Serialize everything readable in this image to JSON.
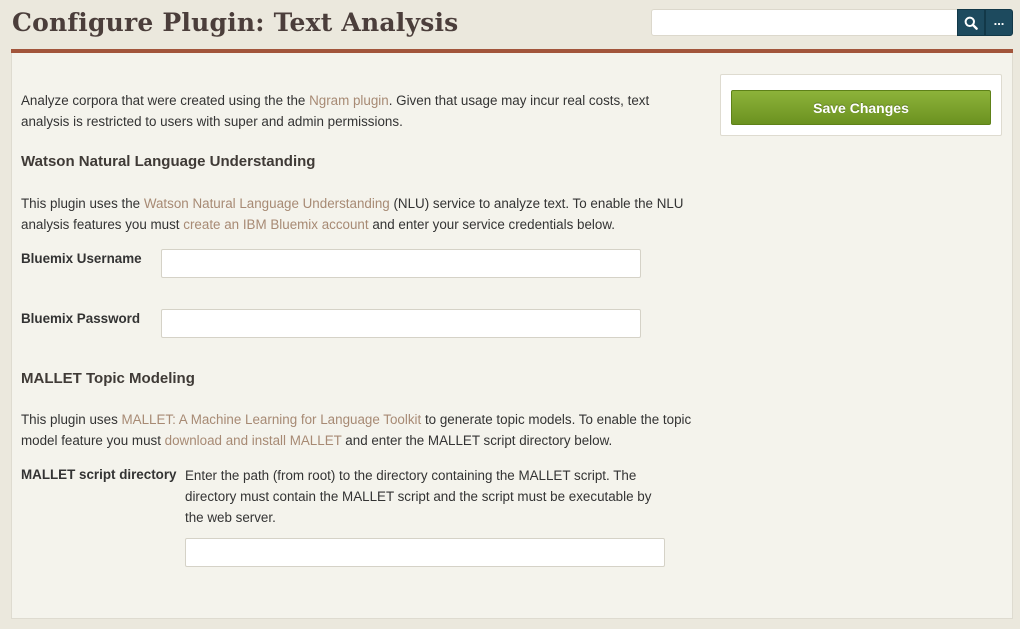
{
  "header": {
    "title": "Configure Plugin: Text Analysis",
    "search": {
      "value": "",
      "placeholder": "",
      "button_icon": "search-icon",
      "options_label": "..."
    }
  },
  "save": {
    "label": "Save Changes"
  },
  "intro": {
    "text_before": "Analyze corpora that were created using the the ",
    "link": "Ngram plugin",
    "text_after": ". Given that usage may incur real costs, text analysis is restricted to users with super and admin permissions."
  },
  "watson": {
    "heading": "Watson Natural Language Understanding",
    "desc_1": "This plugin uses the ",
    "link_1": "Watson Natural Language Understanding",
    "desc_2": " (NLU) service to analyze text. To enable the NLU analysis features you must ",
    "link_2": "create an IBM Bluemix account",
    "desc_3": " and enter your service credentials below.",
    "username_label": "Bluemix Username",
    "username_value": "",
    "password_label": "Bluemix Password",
    "password_value": ""
  },
  "mallet": {
    "heading": "MALLET Topic Modeling",
    "desc_1": "This plugin uses ",
    "link_1": "MALLET: A Machine Learning for Language Toolkit",
    "desc_2": " to generate topic models. To enable the topic model feature you must ",
    "link_2": "download and install MALLET",
    "desc_3": " and enter the MALLET script directory below.",
    "dir_label": "MALLET script directory",
    "dir_hint": "Enter the path (from root) to the directory containing the MALLET script. The directory must contain the MALLET script and the script must be executable by the web server.",
    "dir_value": ""
  },
  "colors": {
    "accent_rule": "#a2553b",
    "save_button": "#7aa22c",
    "search_button": "#1d4a5e",
    "link": "#a78a74"
  }
}
